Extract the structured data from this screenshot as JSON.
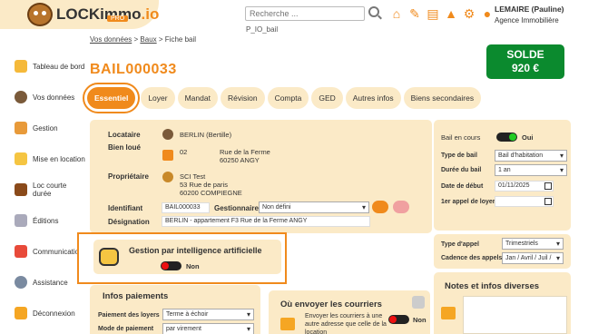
{
  "brand": {
    "name": "LOCKimmo",
    "suffix": ".io",
    "badge": "PRO"
  },
  "search": {
    "placeholder": "Recherche ..."
  },
  "account_code": "P_IO_bail",
  "user": {
    "name": "LEMAIRE (Pauline)",
    "agency": "Agence Immobilière"
  },
  "top_icons": [
    "home-icon",
    "edit-icon",
    "document-icon",
    "alert-icon",
    "gear-icon",
    "user-icon"
  ],
  "sidebar": {
    "items": [
      {
        "label": "Tableau de bord",
        "icon": "dashboard-icon"
      },
      {
        "label": "Vos données",
        "icon": "person-icon"
      },
      {
        "label": "Gestion",
        "icon": "management-icon"
      },
      {
        "label": "Mise en location",
        "icon": "rental-icon"
      },
      {
        "label": "Loc courte durée",
        "icon": "suitcase-icon"
      },
      {
        "label": "Éditions",
        "icon": "print-icon"
      },
      {
        "label": "Communication",
        "icon": "communication-icon"
      },
      {
        "label": "Assistance",
        "icon": "assistance-icon"
      },
      {
        "label": "Déconnexion",
        "icon": "logout-icon"
      }
    ]
  },
  "breadcrumb": {
    "root": "Vos données",
    "sep": ">",
    "middle": "Baux",
    "current": "Fiche bail"
  },
  "page_title": "BAIL000033",
  "solde": {
    "label": "SOLDE",
    "amount": "920 €"
  },
  "tabs": [
    "Essentiel",
    "Loyer",
    "Mandat",
    "Révision",
    "Compta",
    "GED",
    "Autres infos",
    "Biens secondaires"
  ],
  "main": {
    "locataire_label": "Locataire",
    "locataire_value": "BERLIN (Bertille)",
    "bien_label": "Bien loué",
    "bien_number": "02",
    "bien_street": "Rue de la Ferme",
    "bien_city": "60250 ANGY",
    "proprietaire_label": "Propriétaire",
    "prop_name": "SCI Test",
    "prop_street": "53 Rue de paris",
    "prop_city": "60200 COMPIEGNE",
    "identifiant_label": "Identifiant",
    "identifiant_value": "BAIL000033",
    "gestionnaire_label": "Gestionnaire",
    "gestionnaire_value": "Non défini",
    "designation_label": "Désignation",
    "designation_value": "BERLIN - appartement F3 Rue de la Ferme ANGY"
  },
  "ia": {
    "title": "Gestion par intelligence artificielle",
    "toggle_label": "Non"
  },
  "right": {
    "bail_en_cours_label": "Bail en cours",
    "bail_en_cours_value": "Oui",
    "type_bail_label": "Type de bail",
    "type_bail_value": "Bail d'habitation",
    "duree_label": "Durée du bail",
    "duree_value": "1 an",
    "date_debut_label": "Date de début",
    "date_debut_value": "01/11/2025",
    "premier_appel_label": "1er appel de loyer",
    "premier_appel_value": ""
  },
  "appel": {
    "type_label": "Type d'appel",
    "type_value": "Trimestriels",
    "cadence_label": "Cadence des appels",
    "cadence_value": "Jan / Avril / Juil /"
  },
  "paiements": {
    "title": "Infos paiements",
    "periode_label": "Paiement des loyers",
    "periode_value": "Terme à échoir",
    "mode_label": "Mode de paiement",
    "mode_value": "par virement"
  },
  "courriers": {
    "title": "Où envoyer les courriers",
    "desc": "Envoyer les courriers à une autre adresse que celle de la location",
    "toggle_label": "Non"
  },
  "notes": {
    "title": "Notes et infos diverses"
  },
  "colors": {
    "accent": "#f08a1c",
    "panel": "#fbeac7",
    "solde": "#0b8a2e"
  }
}
